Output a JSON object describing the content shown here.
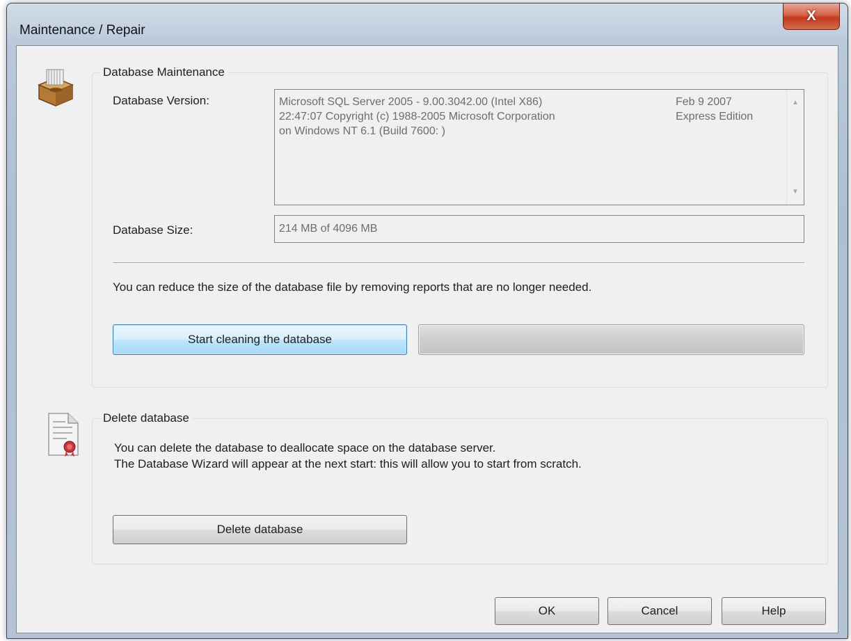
{
  "window": {
    "title": "Maintenance / Repair",
    "close_glyph": "X"
  },
  "db_maintenance": {
    "legend": "Database Maintenance",
    "icon": "database-icon",
    "version_label": "Database Version:",
    "version_lines": [
      "Microsoft SQL Server 2005 - 9.00.3042.00 (Intel X86)",
      "22:47:07 Copyright (c) 1988-2005 Microsoft Corporation",
      "on Windows NT 6.1 (Build 7600: )"
    ],
    "version_right_lines": [
      "Feb  9 2007",
      "Express Edition"
    ],
    "size_label": "Database Size:",
    "size_value": "214 MB of 4096 MB",
    "info_text": "You can reduce the size of the database file by removing reports that are no longer needed.",
    "clean_button": "Start cleaning the database",
    "progress_value": 0
  },
  "delete_db": {
    "legend": "Delete database",
    "icon": "certificate-document-icon",
    "text_lines": [
      "You can delete the database to deallocate space on the database server.",
      "The Database Wizard will appear at the next start: this will allow you to start from scratch."
    ],
    "delete_button": "Delete database"
  },
  "footer": {
    "ok": "OK",
    "cancel": "Cancel",
    "help": "Help"
  },
  "colors": {
    "close_button": "#c2381e",
    "default_button_border": "#3c7fb1",
    "progress_track": "#cdcdcd"
  }
}
